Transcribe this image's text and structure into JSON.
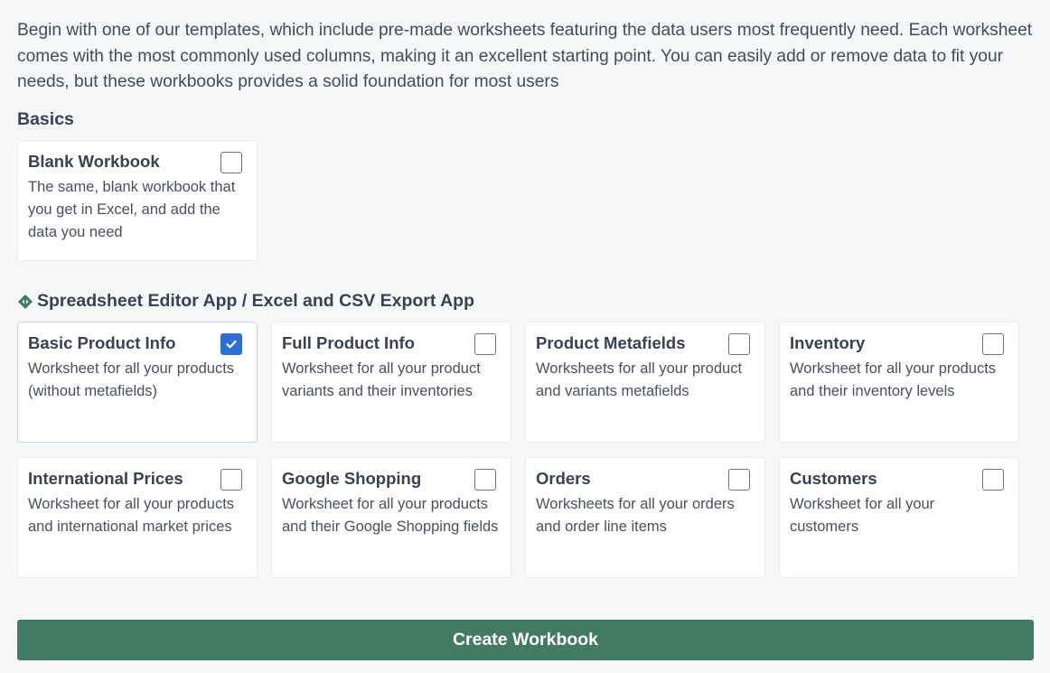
{
  "intro": "Begin with one of our templates, which include pre-made worksheets featuring the data users most frequently need. Each worksheet comes with the most commonly used columns, making it an excellent starting point. You can easily add or remove data to fit your needs, but these workbooks provides a solid foundation for most users",
  "sections": [
    {
      "title": "Basics",
      "icon": null,
      "cards": [
        {
          "title": "Blank Workbook",
          "description": "The same, blank workbook that you get in Excel, and add the data you need",
          "checked": false
        }
      ]
    },
    {
      "title": "Spreadsheet Editor App / Excel and CSV Export App",
      "icon": "app-diamond-icon",
      "cards": [
        {
          "title": "Basic Product Info",
          "description": "Worksheet for all your products (without metafields)",
          "checked": true
        },
        {
          "title": "Full Product Info",
          "description": "Worksheet for all your product variants and their inventories",
          "checked": false
        },
        {
          "title": "Product Metafields",
          "description": "Worksheets for all your product and variants metafields",
          "checked": false
        },
        {
          "title": "Inventory",
          "description": "Worksheet for all your products and their inventory levels",
          "checked": false
        },
        {
          "title": "International Prices",
          "description": "Worksheet for all your products and international market prices",
          "checked": false
        },
        {
          "title": "Google Shopping",
          "description": "Worksheet for all your products and their Google Shopping fields",
          "checked": false
        },
        {
          "title": "Orders",
          "description": "Worksheets for all your orders and order line items",
          "checked": false
        },
        {
          "title": "Customers",
          "description": "Worksheet for all your customers",
          "checked": false
        }
      ]
    }
  ],
  "create_button": {
    "label": "Create Workbook"
  },
  "colors": {
    "accent_green": "#437a63",
    "checkbox_blue": "#2b6fd6",
    "background": "#f6f7f9"
  }
}
